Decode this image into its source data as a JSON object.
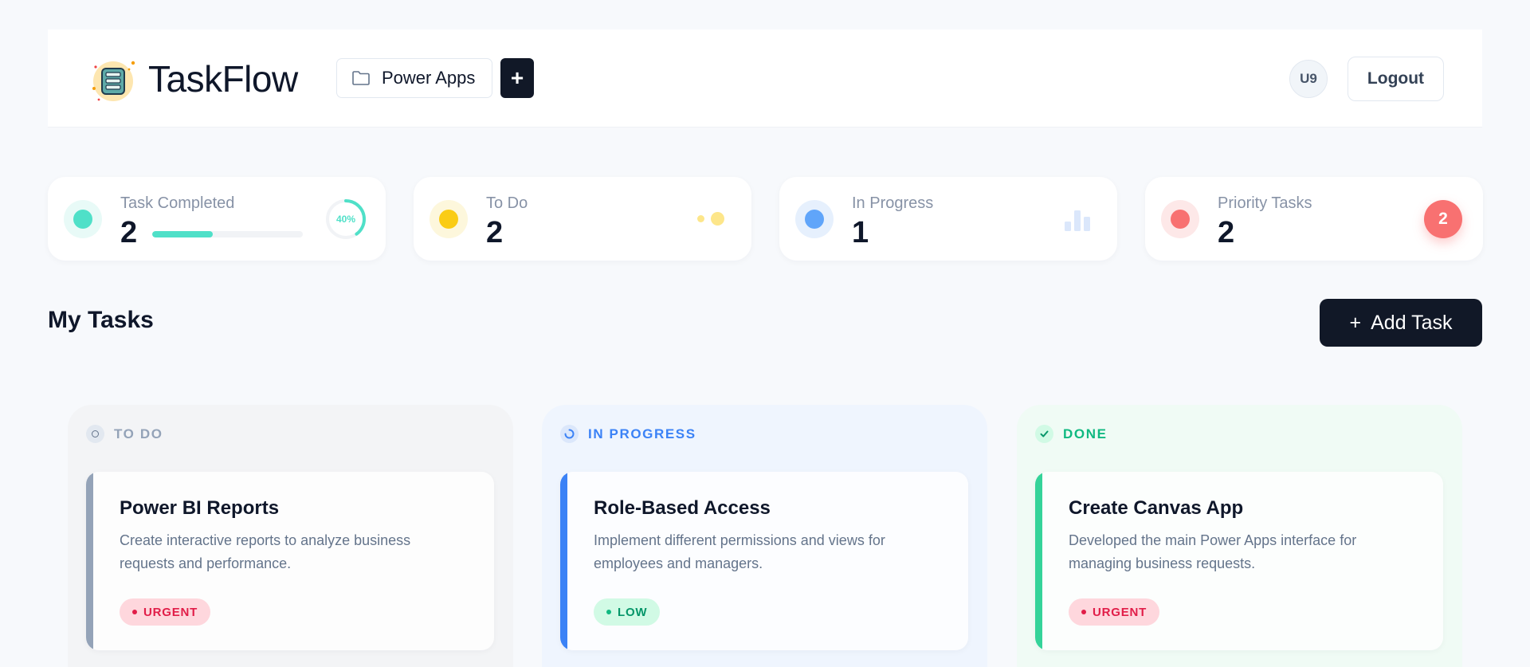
{
  "header": {
    "brand": "TaskFlow",
    "project": "Power Apps",
    "add_project": "+",
    "avatar": "U9",
    "logout": "Logout"
  },
  "stats": [
    {
      "label": "Task Completed",
      "value": "2",
      "percent_label": "40%",
      "progress": 0.4,
      "color": "#4fe0c8",
      "soft": "#e8faf7"
    },
    {
      "label": "To Do",
      "value": "2",
      "color": "#facc15",
      "soft": "#fdf7dc"
    },
    {
      "label": "In Progress",
      "value": "1",
      "color": "#60a5fa",
      "soft": "#e6f0fd"
    },
    {
      "label": "Priority Tasks",
      "value": "2",
      "badge": "2",
      "color": "#f87171",
      "soft": "#fde8e8"
    }
  ],
  "section": {
    "title": "My Tasks",
    "add_task": "Add Task",
    "add_icon": "+"
  },
  "columns": [
    {
      "title": "TO DO",
      "accent": "#94a3b8",
      "card": {
        "title": "Power BI Reports",
        "description": "Create interactive reports to analyze business requests and performance.",
        "priority": "URGENT"
      }
    },
    {
      "title": "IN PROGRESS",
      "accent": "#3b82f6",
      "card": {
        "title": "Role-Based Access",
        "description": "Implement different permissions and views for employees and managers.",
        "priority": "LOW"
      }
    },
    {
      "title": "DONE",
      "accent": "#34d399",
      "card": {
        "title": "Create Canvas App",
        "description": "Developed the main Power Apps interface for managing business requests.",
        "priority": "URGENT"
      }
    }
  ]
}
